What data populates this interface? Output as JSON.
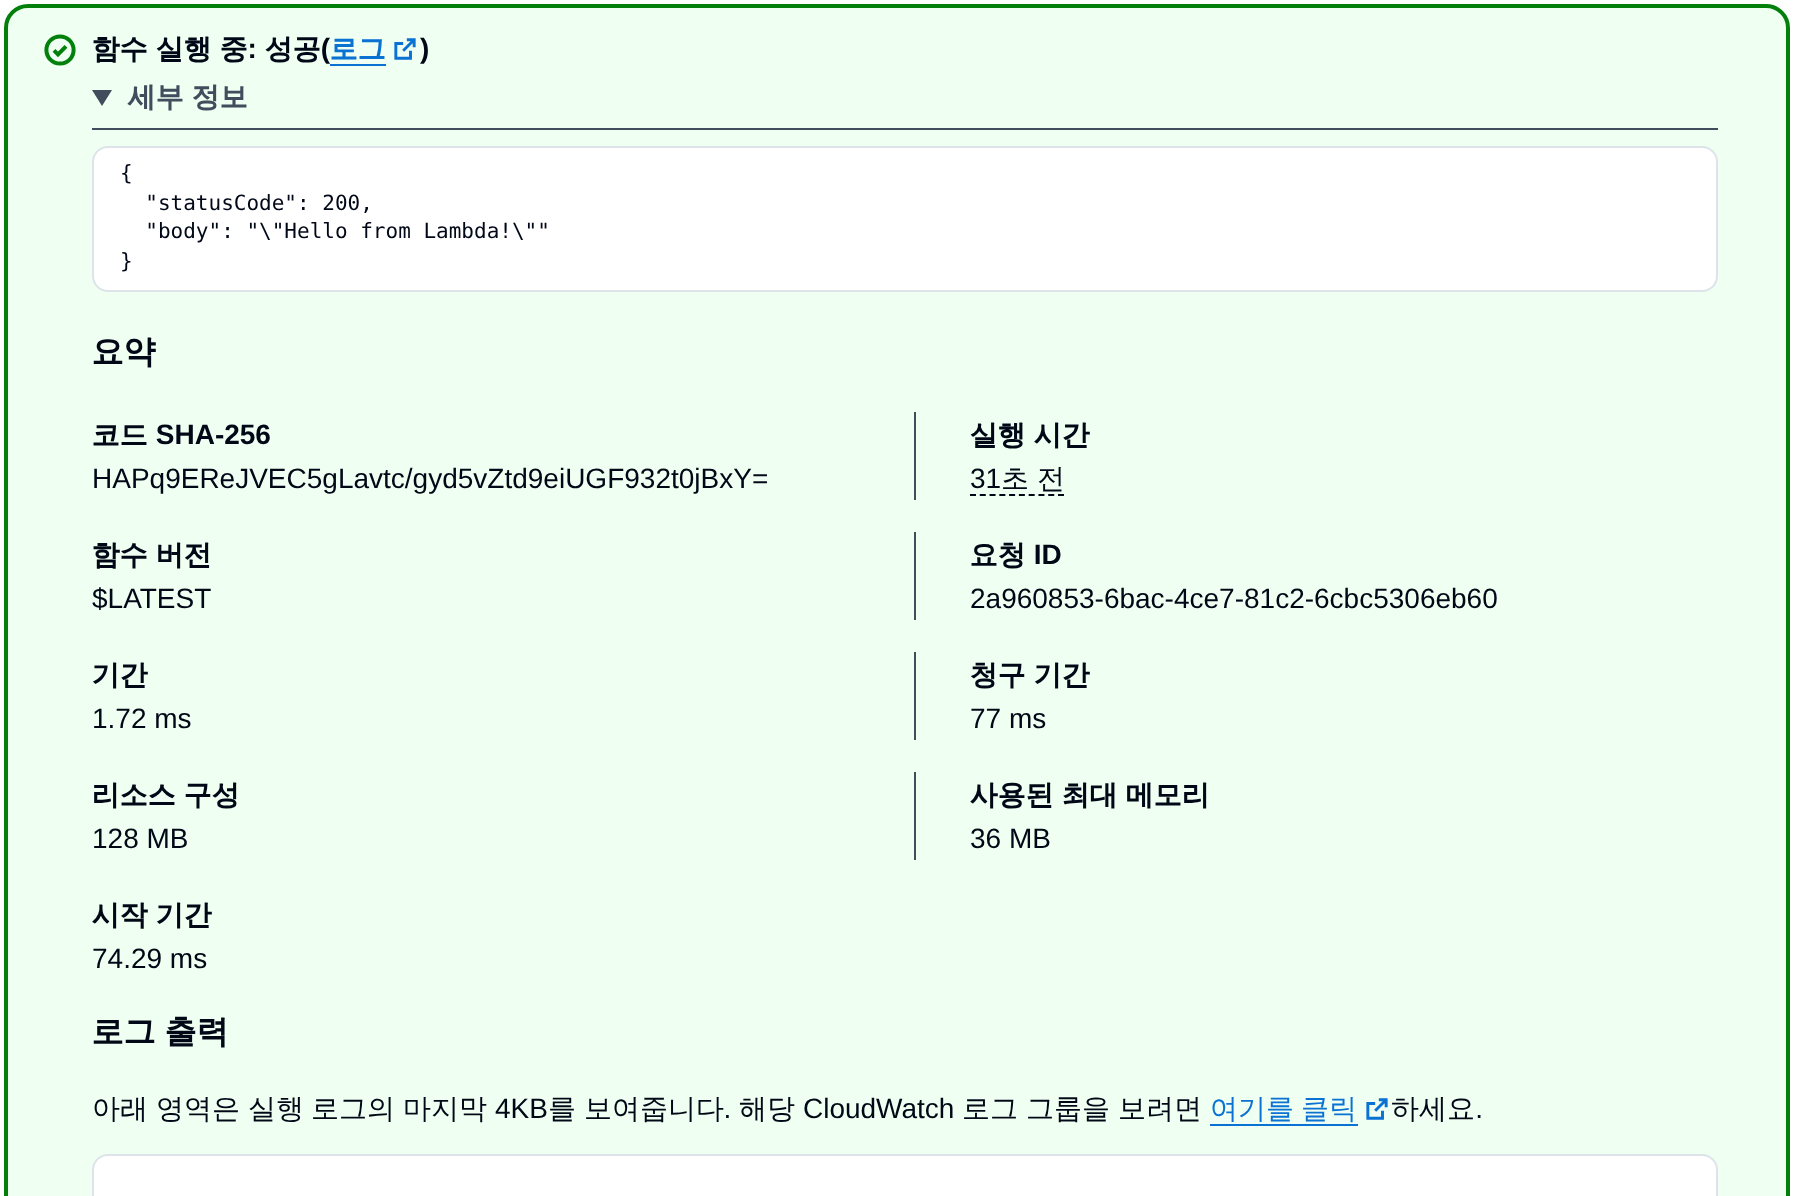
{
  "status": {
    "kind": "success",
    "title_prefix": "함수 실행 중: 성공(",
    "link": "로그",
    "title_suffix": ")"
  },
  "details": {
    "label": "세부 정보",
    "expanded": true,
    "output": "{\n  \"statusCode\": 200,\n  \"body\": \"\\\"Hello from Lambda!\\\"\"\n}"
  },
  "summary": {
    "title": "요약",
    "rows": [
      {
        "left": {
          "label": "코드 SHA-256",
          "value": "HAPq9EReJVEC5gLavtc/gyd5vZtd9eiUGF932t0jBxY=",
          "kind": "text"
        },
        "right": {
          "label": "실행 시간",
          "value": "31초 전",
          "kind": "time"
        }
      },
      {
        "left": {
          "label": "함수 버전",
          "value": "$LATEST",
          "kind": "text"
        },
        "right": {
          "label": "요청 ID",
          "value": "2a960853-6bac-4ce7-81c2-6cbc5306eb60",
          "kind": "text"
        }
      },
      {
        "left": {
          "label": "기간",
          "value": "1.72 ms",
          "kind": "text"
        },
        "right": {
          "label": "청구 기간",
          "value": "77 ms",
          "kind": "text"
        }
      },
      {
        "left": {
          "label": "리소스 구성",
          "value": "128 MB",
          "kind": "text"
        },
        "right": {
          "label": "사용된 최대 메모리",
          "value": "36 MB",
          "kind": "text"
        }
      },
      {
        "left": {
          "label": "시작 기간",
          "value": "74.29 ms",
          "kind": "text"
        }
      }
    ]
  },
  "log_output": {
    "title": "로그 출력",
    "text_before": "아래 영역은 실행 로그의 마지막 4KB를 보여줍니다. 해당 CloudWatch 로그 그룹을 보려면 ",
    "link": "여기를 클릭",
    "text_after": "하세요."
  }
}
